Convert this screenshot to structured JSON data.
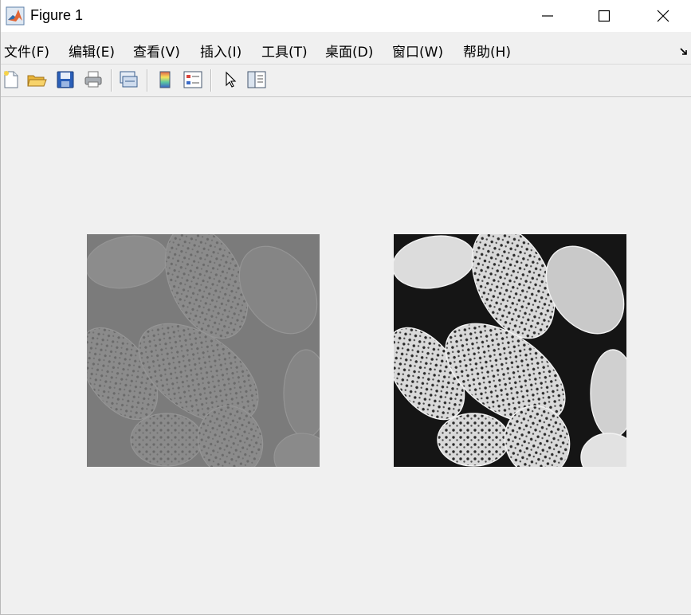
{
  "window": {
    "title": "Figure 1",
    "icon": "matlab-icon",
    "controls": [
      "minimize-icon",
      "maximize-icon",
      "close-icon"
    ]
  },
  "menu": {
    "items": [
      {
        "label": "文件(F)"
      },
      {
        "label": "编辑(E)"
      },
      {
        "label": "查看(V)"
      },
      {
        "label": "插入(I)"
      },
      {
        "label": "工具(T)"
      },
      {
        "label": "桌面(D)"
      },
      {
        "label": "窗口(W)"
      },
      {
        "label": "帮助(H)"
      }
    ],
    "dock_icon": "dock-arrow-icon"
  },
  "toolbar": {
    "tools": [
      "new-figure-icon",
      "open-file-icon",
      "save-icon",
      "print-icon",
      "link-plot-icon",
      "insert-colorbar-icon",
      "insert-legend-icon",
      "edit-plot-arrow-icon",
      "property-inspector-icon"
    ]
  },
  "images": [
    {
      "name": "low-contrast-pollen-image",
      "description_colors": {
        "base": "#7d7d7d",
        "grain": "#8e8e8e"
      }
    },
    {
      "name": "enhanced-pollen-image",
      "description_colors": {
        "base": "#1a1a1a",
        "grain": "#d8d8d8"
      }
    }
  ],
  "colors": {
    "background": "#f0f0f0",
    "titlebar": "#ffffff",
    "matlab_orange": "#e16737",
    "matlab_blue": "#2a6eb0"
  }
}
